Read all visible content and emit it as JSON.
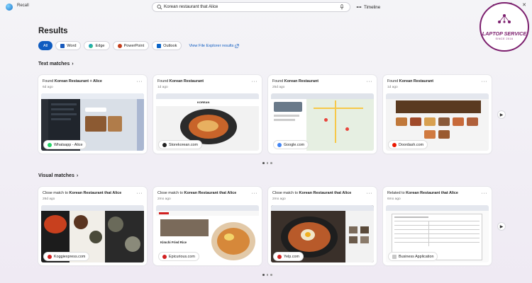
{
  "app": {
    "name": "Recall"
  },
  "search": {
    "query": "Korean restaurant that Alice",
    "timeline_label": "Timeline"
  },
  "window_controls": {
    "minimize": "—",
    "maximize": "☐",
    "close": "✕"
  },
  "watermark": {
    "name": "LAPTOP SERVICE",
    "tagline": "SINCE 2016"
  },
  "results": {
    "title": "Results"
  },
  "filters": [
    {
      "label": "All",
      "active": true,
      "icon": ""
    },
    {
      "label": "Word",
      "active": false,
      "icon": "word-icon",
      "color": "#185abd"
    },
    {
      "label": "Edge",
      "active": false,
      "icon": "edge-icon",
      "color": "#0f8fd1"
    },
    {
      "label": "PowerPoint",
      "active": false,
      "icon": "powerpoint-icon",
      "color": "#c43e1c"
    },
    {
      "label": "Outlook",
      "active": false,
      "icon": "outlook-icon",
      "color": "#0a64c8"
    }
  ],
  "explorer_link": "View File Explorer results",
  "text_matches": {
    "label": "Text matches",
    "cards": [
      {
        "prefix": "Found",
        "bold": "Korean Restaurant + Alice",
        "date": "6d ago",
        "source": "Whatsapp - Alice",
        "source_color": "#25d366"
      },
      {
        "prefix": "Found",
        "bold": "Korean Restaurant",
        "date": "1d ago",
        "source": "Storekorean.com",
        "source_color": "#222222"
      },
      {
        "prefix": "Found",
        "bold": "Korean Restaurant",
        "date": "25d ago",
        "source": "Google.com",
        "source_color": "#4285f4"
      },
      {
        "prefix": "Found",
        "bold": "Korean Restaurant",
        "date": "1d ago",
        "source": "Doordash.com",
        "source_color": "#eb1700"
      }
    ]
  },
  "visual_matches": {
    "label": "Visual matches",
    "cards": [
      {
        "prefix": "Close match to",
        "bold": "Korean Restaurant that Alice",
        "date": "26d ago",
        "source": "Koggiexpress.com",
        "source_color": "#d12020"
      },
      {
        "prefix": "Close match to",
        "bold": "Korean Restaurant that Alice",
        "date": "2mo ago",
        "source": "Epicurious.com",
        "source_color": "#d12020"
      },
      {
        "prefix": "Close match to",
        "bold": "Korean Restaurant that Alice",
        "date": "2mo ago",
        "source": "Yelp.com",
        "source_color": "#d32323"
      },
      {
        "prefix": "Related to",
        "bold": "Korean Restaurant that Alice",
        "date": "6mo ago",
        "source": "Business Application",
        "source_color": "#c8c8c8"
      }
    ]
  },
  "thumb_text": {
    "storekorean_logo": "KOREAN",
    "kimchi_title": "Kimchi Fried Rice"
  }
}
